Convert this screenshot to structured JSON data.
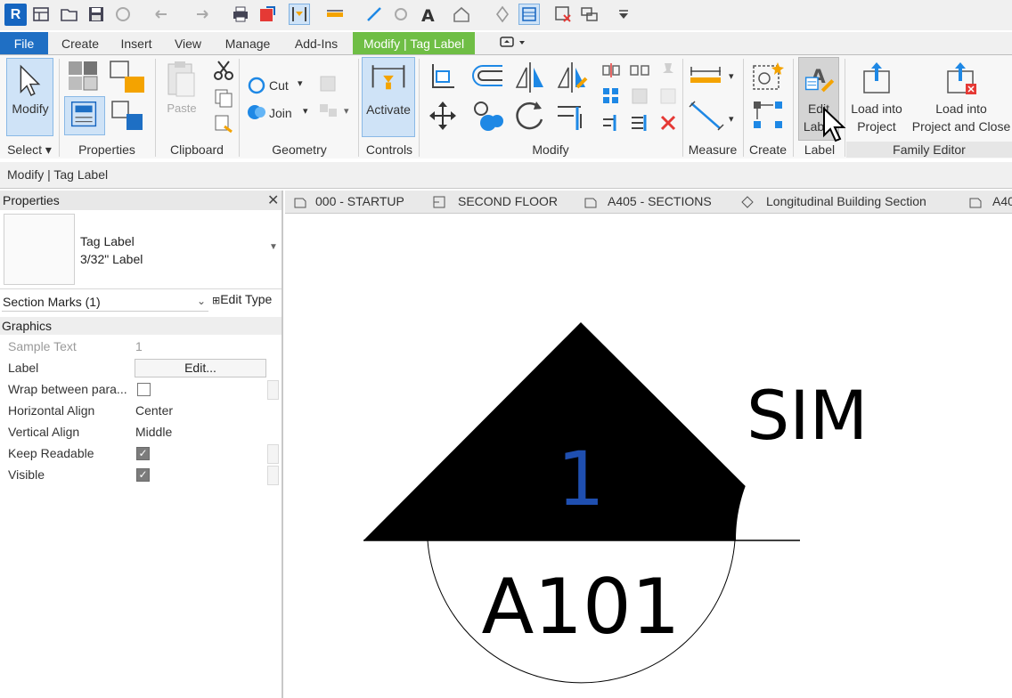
{
  "ribbon_tabs": [
    "File",
    "Create",
    "Insert",
    "View",
    "Manage",
    "Add-Ins",
    "Modify | Tag Label"
  ],
  "panels": {
    "select": "Select",
    "properties": "Properties",
    "clipboard": "Clipboard",
    "geometry": "Geometry",
    "controls": "Controls",
    "modify": "Modify",
    "measure": "Measure",
    "create": "Create",
    "label": "Label",
    "family_editor": "Family Editor"
  },
  "buttons": {
    "modify": "Modify",
    "paste": "Paste",
    "cut": "Cut",
    "join": "Join",
    "activate": "Activate",
    "edit_label_1": "Edit",
    "edit_label_2": "Label",
    "load_project_1": "Load into",
    "load_project_2": "Project",
    "load_close_1": "Load into",
    "load_close_2": "Project and Close"
  },
  "options_bar": "Modify | Tag Label",
  "properties": {
    "title": "Properties",
    "close": "✕",
    "type_line1": "Tag Label",
    "type_line2": "3/32\" Label",
    "filter": "Section Marks (1)",
    "edit_type": "Edit Type",
    "group": "Graphics",
    "rows": [
      {
        "name": "Sample Text",
        "value": "1"
      },
      {
        "name": "Label",
        "value": "Edit..."
      },
      {
        "name": "Wrap between para...",
        "value": ""
      },
      {
        "name": "Horizontal Align",
        "value": "Center"
      },
      {
        "name": "Vertical Align",
        "value": "Middle"
      },
      {
        "name": "Keep Readable",
        "value": "checked"
      },
      {
        "name": "Visible",
        "value": "checked"
      }
    ]
  },
  "view_tabs": [
    "000 - STARTUP",
    "SECOND FLOOR",
    "A405 - SECTIONS",
    "Longitudinal Building Section",
    "A40"
  ],
  "drawing": {
    "sample_number": "1",
    "sheet": "A101",
    "note": "SIM",
    "number_color": "#1f4fb0"
  },
  "colors": {
    "file_tab": "#1f6fc4",
    "context_tab": "#6fbe45",
    "accent_blue": "#1e88e5"
  }
}
